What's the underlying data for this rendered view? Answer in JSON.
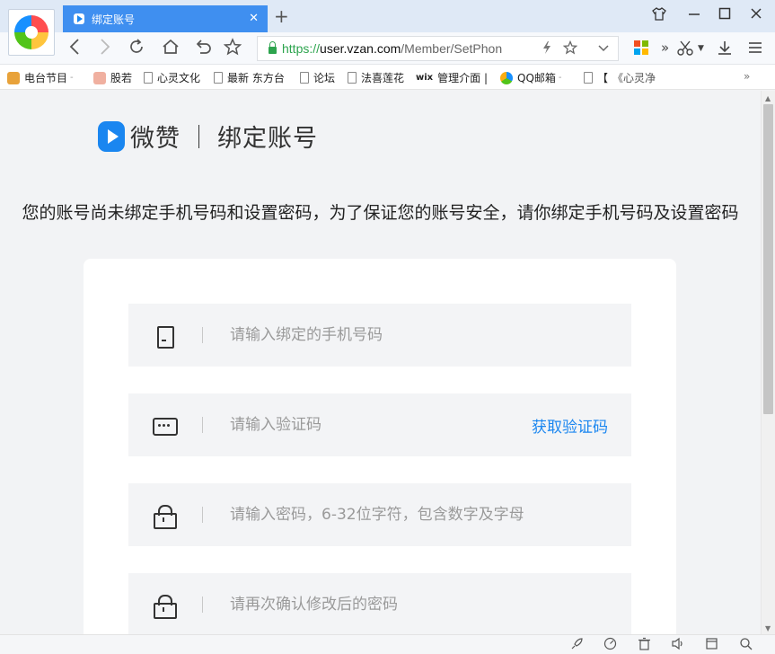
{
  "browser": {
    "tab_title": "绑定账号",
    "tab_close": "✕",
    "new_tab": "+",
    "url_protocol": "https://",
    "url_host": "user.vzan.com",
    "url_path": "/Member/SetPhon",
    "icons": {
      "window": [
        "shirt-icon",
        "minimize-icon",
        "maximize-icon",
        "close-icon"
      ],
      "nav": [
        "back-icon",
        "forward-icon",
        "refresh-icon",
        "home-icon",
        "undo-icon",
        "star-icon"
      ],
      "right": [
        "apps-icon",
        "more-icon",
        "scissors-icon",
        "download-icon",
        "menu-icon"
      ]
    }
  },
  "bookmarks": [
    {
      "label": "电台节目",
      "has_arrow": true
    },
    {
      "label": "股若",
      "has_arrow": false
    },
    {
      "label": "心灵文化",
      "has_arrow": false
    },
    {
      "label": "最新 东方台",
      "has_arrow": false
    },
    {
      "label": "论坛",
      "has_arrow": false
    },
    {
      "label": "法喜莲花",
      "has_arrow": false
    },
    {
      "label": "管理介面 |",
      "has_arrow": false
    },
    {
      "label": "QQ邮箱",
      "has_arrow": true
    },
    {
      "label": "【",
      "has_arrow": false
    },
    {
      "label": "《心灵净",
      "has_arrow": false
    }
  ],
  "bookmark_prefix_wix": "wix",
  "bookmarks_more": "»",
  "page": {
    "brand_name": "微赞",
    "title": "绑定账号",
    "notice": "您的账号尚未绑定手机号码和设置密码，为了保证您的账号安全，请你绑定手机号码及设置密码",
    "fields": {
      "phone_placeholder": "请输入绑定的手机号码",
      "code_placeholder": "请输入验证码",
      "get_code_label": "获取验证码",
      "password_placeholder": "请输入密码，6-32位字符，包含数字及字母",
      "confirm_placeholder": "请再次确认修改后的密码"
    },
    "accent_color": "#1a86f0"
  }
}
